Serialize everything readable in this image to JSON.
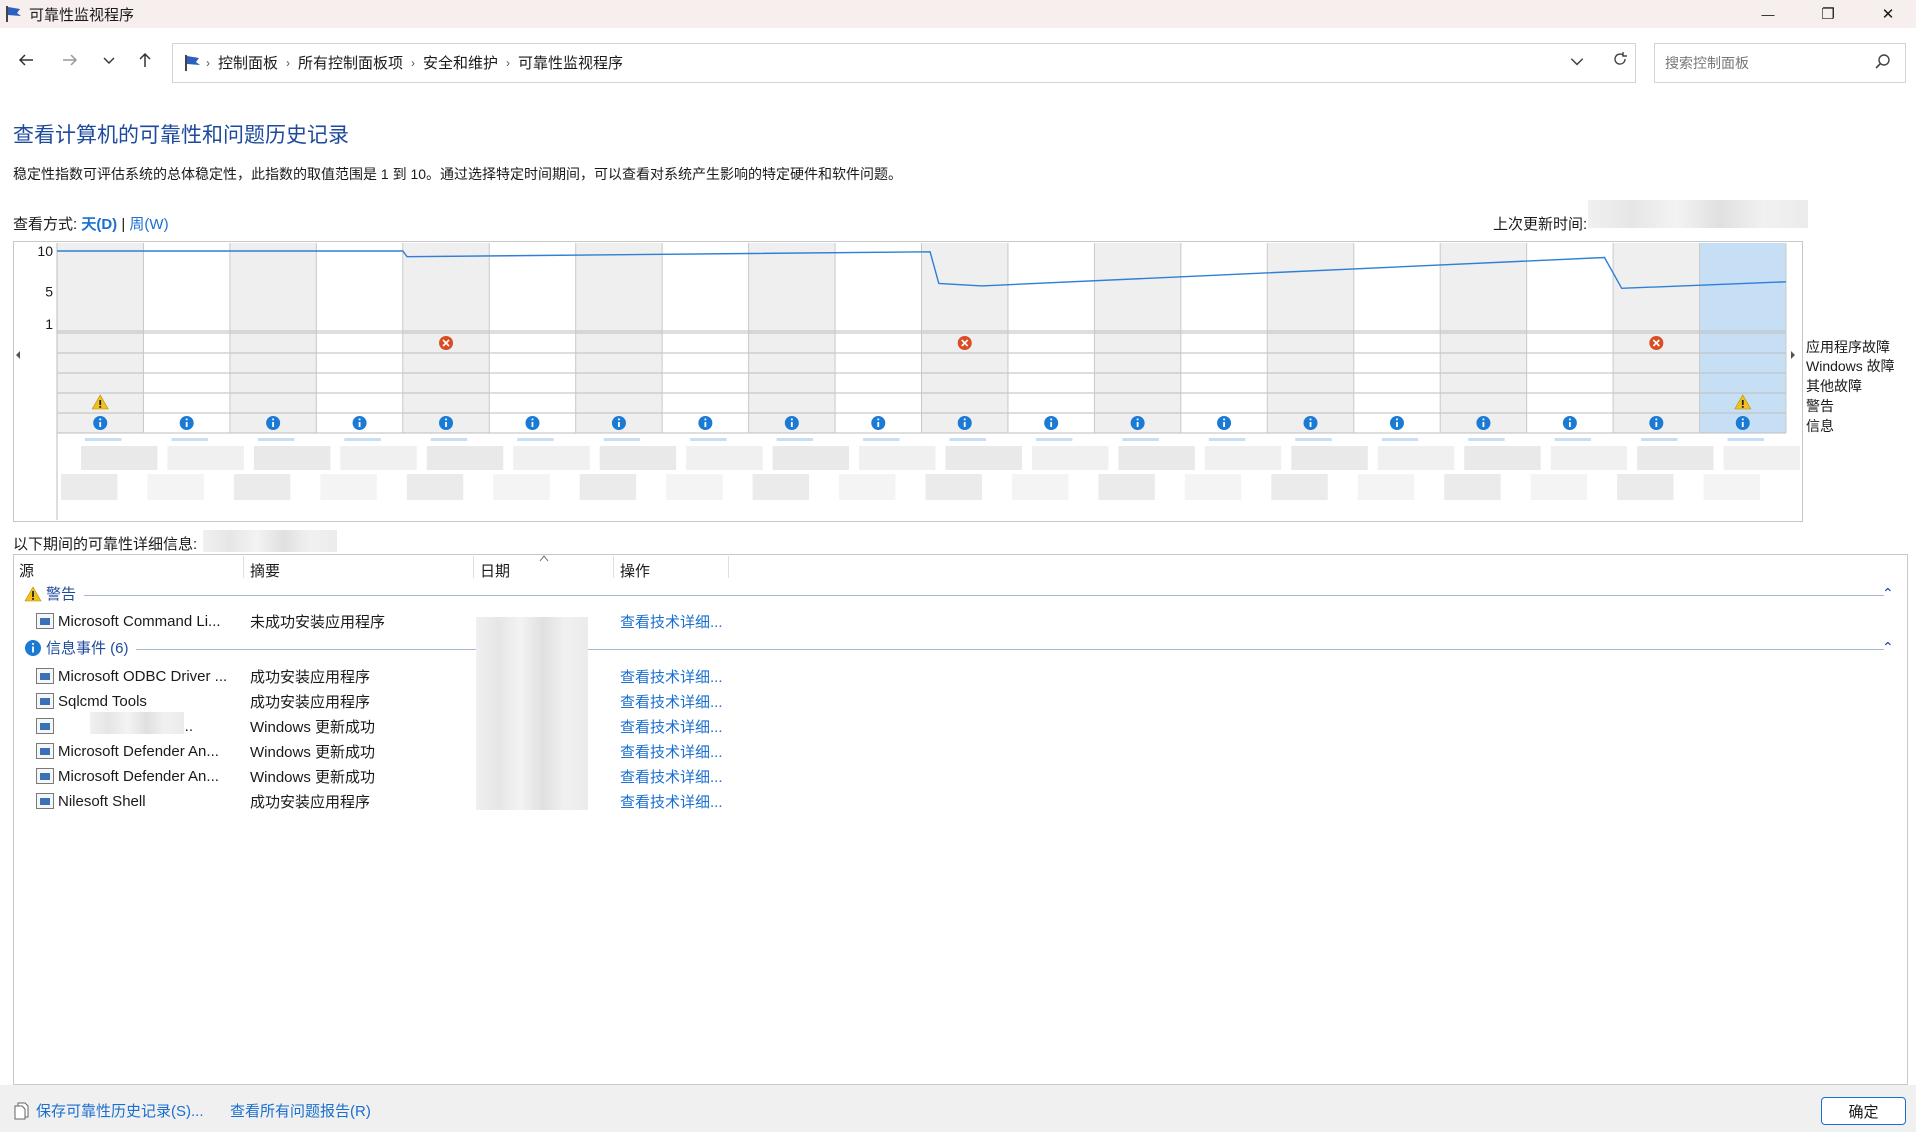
{
  "window": {
    "title": "可靠性监视程序",
    "minimize_glyph": "—",
    "maximize_glyph": "❐",
    "close_glyph": "✕"
  },
  "nav": {
    "back_icon": "arrow-left",
    "forward_icon": "arrow-right",
    "recent_icon": "chevron-down",
    "up_icon": "arrow-up"
  },
  "breadcrumb": [
    "控制面板",
    "所有控制面板项",
    "安全和维护",
    "可靠性监视程序"
  ],
  "search": {
    "placeholder": "搜索控制面板"
  },
  "header": {
    "title": "查看计算机的可靠性和问题历史记录",
    "description": "稳定性指数可评估系统的总体稳定性，此指数的取值范围是 1 到 10。通过选择特定时间期间，可以查看对系统产生影响的特定硬件和软件问题。",
    "view_label": "查看方式:",
    "view_day": "天(D)",
    "view_sep": "|",
    "view_week": "周(W)",
    "updated_label": "上次更新时间:"
  },
  "chart_data": {
    "type": "line",
    "title": "",
    "y_ticks": [
      10,
      5,
      1
    ],
    "ylim": [
      1,
      10
    ],
    "columns": 20,
    "selected_column": 19,
    "stability_index": [
      {
        "col": 0,
        "y": 10
      },
      {
        "col": 4,
        "y": 10
      },
      {
        "col": 4.05,
        "y": 9.3
      },
      {
        "col": 10.1,
        "y": 9.9
      },
      {
        "col": 10.2,
        "y": 6.0
      },
      {
        "col": 10.7,
        "y": 5.7
      },
      {
        "col": 17.9,
        "y": 9.2
      },
      {
        "col": 18.1,
        "y": 5.4
      },
      {
        "col": 20,
        "y": 6.2
      }
    ],
    "rows": [
      "应用程序故障",
      "Windows 故障",
      "其他故障",
      "警告",
      "信息"
    ],
    "events": {
      "应用程序故障": [
        4,
        10,
        18
      ],
      "Windows 故障": [],
      "其他故障": [],
      "警告": [
        0,
        19
      ],
      "信息": [
        0,
        1,
        2,
        3,
        4,
        5,
        6,
        7,
        8,
        9,
        10,
        11,
        12,
        13,
        14,
        15,
        16,
        17,
        18,
        19
      ]
    }
  },
  "details": {
    "label": "以下期间的可靠性详细信息:",
    "columns": [
      "源",
      "摘要",
      "日期",
      "操作"
    ],
    "groups": [
      {
        "title": "警告",
        "rows": [
          {
            "source": "Microsoft Command Li...",
            "summary": "未成功安装应用程序",
            "action": "查看技术详细..."
          }
        ]
      },
      {
        "title": "信息事件 (6)",
        "rows": [
          {
            "source": "Microsoft ODBC Driver ...",
            "summary": "成功安装应用程序",
            "action": "查看技术详细..."
          },
          {
            "source": "Sqlcmd Tools",
            "summary": "成功安装应用程序",
            "action": "查看技术详细..."
          },
          {
            "source": "-Micr...",
            "summary": "Windows 更新成功",
            "action": "查看技术详细..."
          },
          {
            "source": "Microsoft Defender An...",
            "summary": "Windows 更新成功",
            "action": "查看技术详细..."
          },
          {
            "source": "Microsoft Defender An...",
            "summary": "Windows 更新成功",
            "action": "查看技术详细..."
          },
          {
            "source": "Nilesoft Shell",
            "summary": "成功安装应用程序",
            "action": "查看技术详细..."
          }
        ]
      }
    ]
  },
  "footer": {
    "save_link": "保存可靠性历史记录(S)...",
    "reports_link": "查看所有问题报告(R)",
    "ok": "确定"
  }
}
